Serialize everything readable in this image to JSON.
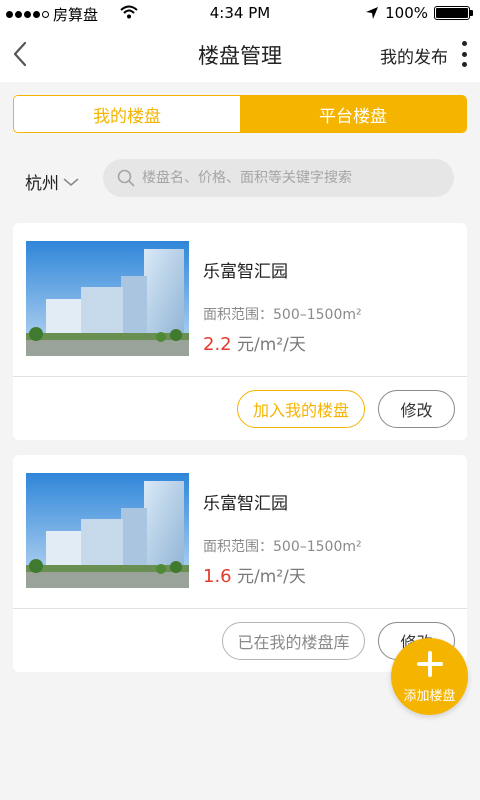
{
  "status_bar": {
    "carrier": "房算盘",
    "time": "4:34 PM",
    "battery": "100%",
    "battery_level": 1.0
  },
  "nav": {
    "title": "楼盘管理",
    "action": "我的发布"
  },
  "tabs": [
    {
      "label": "我的楼盘",
      "active": false
    },
    {
      "label": "平台楼盘",
      "active": true
    }
  ],
  "filter": {
    "city": "杭州",
    "search_placeholder": "楼盘名、价格、面积等关键字搜索"
  },
  "listings": [
    {
      "name": "乐富智汇园",
      "area": "面积范围：500–1500m²",
      "price": "2.2",
      "unit": " 元/m²/天",
      "primary_button": "加入我的楼盘",
      "secondary_button": "修改"
    },
    {
      "name": "乐富智汇园",
      "area": "面积范围：500–1500m²",
      "price": "1.6",
      "unit": " 元/m²/天",
      "primary_button": "已在我的楼盘库",
      "secondary_button": "修改"
    }
  ],
  "fab": {
    "label": "添加楼盘"
  },
  "colors": {
    "accent": "#f5b400",
    "price": "#e53b2e"
  }
}
